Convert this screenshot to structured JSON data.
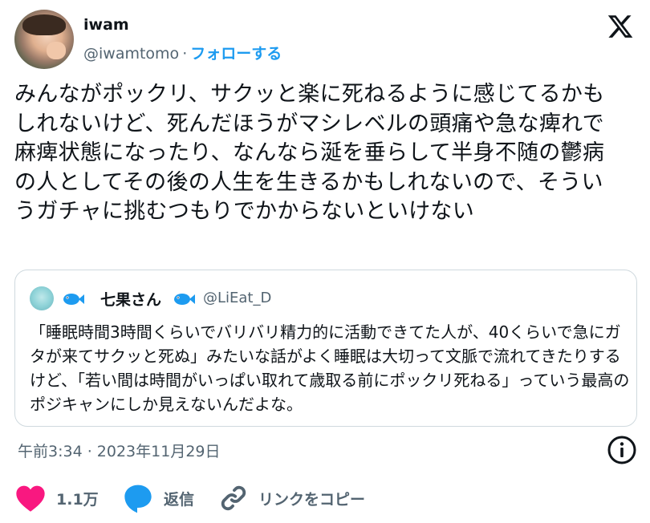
{
  "author": {
    "name": "iwam",
    "handle": "@iwamtomo",
    "separator": "·",
    "follow_label": "フォローする"
  },
  "post": {
    "text": "みんながポックリ、サクッと楽に死ねるように感じてるかもしれないけど、死んだほうがマシレベルの頭痛や急な痺れで麻痺状態になったり、なんなら涎を垂らして半身不随の鬱病の人としてその後の人生を生きるかもしれないので、そういうガチャに挑むつもりでかからないといけない"
  },
  "quote": {
    "name": "七果さん",
    "handle": "@LiEat_D",
    "text": "「睡眠時間3時間くらいでバリバリ精力的に活動できてた人が、40くらいで急にガタが来てサクッと死ぬ」みたいな話がよく睡眠は大切って文脈で流れてきたりするけど、「若い間は時間がいっぱい取れて歳取る前にポックリ死ねる」っていう最高のポジキャンにしか見えないんだよな。"
  },
  "timestamp": "午前3:34 · 2023年11月29日",
  "actions": {
    "like_count": "1.1万",
    "reply_label": "返信",
    "copy_link_label": "リンクをコピー"
  },
  "icons": {
    "logo": "x-logo-icon",
    "info": "info-icon",
    "like": "heart-icon",
    "reply": "speech-bubble-icon",
    "copy_link": "link-icon",
    "quote_decoration": "fish-icon"
  },
  "colors": {
    "accent": "#1d9bf0",
    "like": "#f91880",
    "text_secondary": "#536471",
    "border": "#cfd9de"
  }
}
